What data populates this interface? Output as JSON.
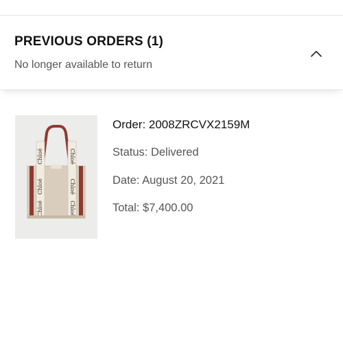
{
  "previous_orders": {
    "title": "PREVIOUS ORDERS (1)",
    "subtitle": "No longer available to return",
    "toggle_icon": "chevron-up-icon"
  },
  "order": {
    "number": "Order: 2008ZRCVX2159M",
    "status": "Status: Delivered",
    "date": "Date: August 20, 2021",
    "total": "Total: $7,400.00",
    "product_image": {
      "brand_marks": [
        "Chloé",
        "Chloé",
        "Chloé",
        "Chloé",
        "Chloé",
        "Chloé"
      ],
      "colors": {
        "canvas": "#d9cdbd",
        "stripe": "#8e3a31",
        "ribbon": "#f1ece2"
      }
    }
  }
}
